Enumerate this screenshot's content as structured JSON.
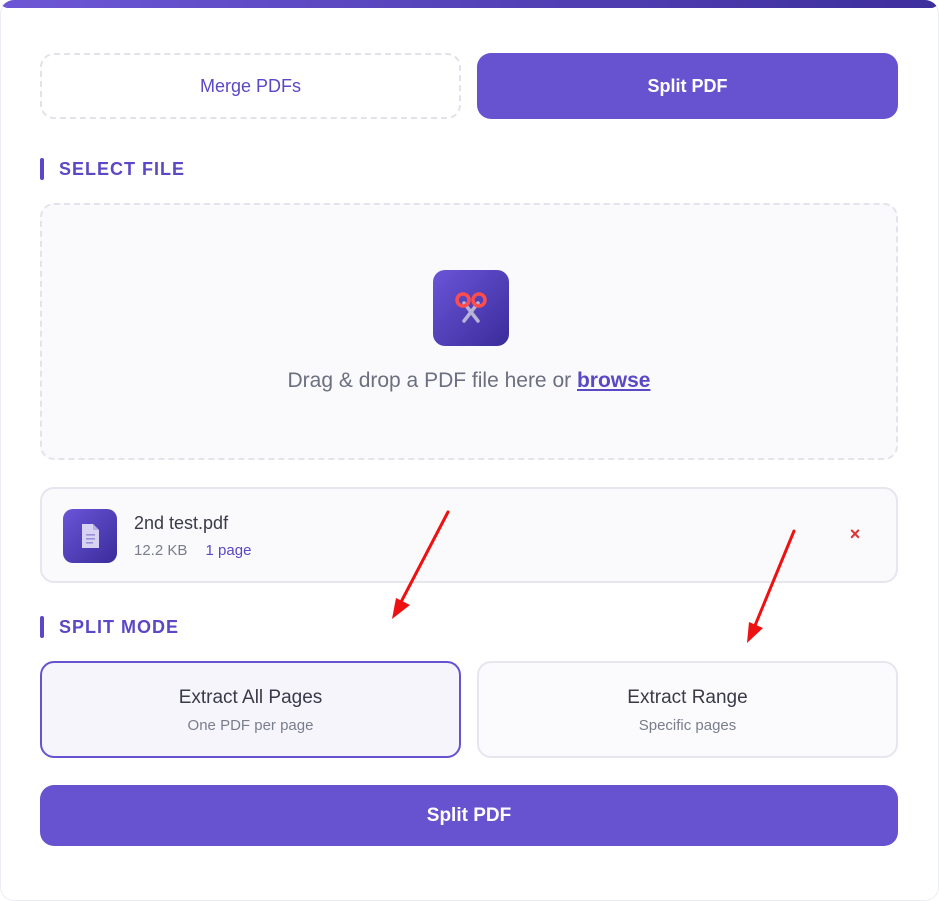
{
  "tabs": {
    "merge_label": "Merge PDFs",
    "split_label": "Split PDF"
  },
  "select_file": {
    "title": "SELECT FILE",
    "dropzone_text": "Drag & drop a PDF file here or",
    "browse_label": "browse",
    "icon": "scissors-icon"
  },
  "file": {
    "name": "2nd test.pdf",
    "size": "12.2 KB",
    "pages": "1 page",
    "remove_label": "×",
    "icon": "document-icon"
  },
  "split_mode": {
    "title": "SPLIT MODE",
    "options": [
      {
        "title": "Extract All Pages",
        "subtitle": "One PDF per page",
        "selected": true
      },
      {
        "title": "Extract Range",
        "subtitle": "Specific pages",
        "selected": false
      }
    ]
  },
  "submit_label": "Split PDF",
  "colors": {
    "accent": "#6753d0",
    "accent_dark": "#3a2c9a",
    "remove": "#e03131",
    "annotation_arrow": "#ee1111"
  }
}
